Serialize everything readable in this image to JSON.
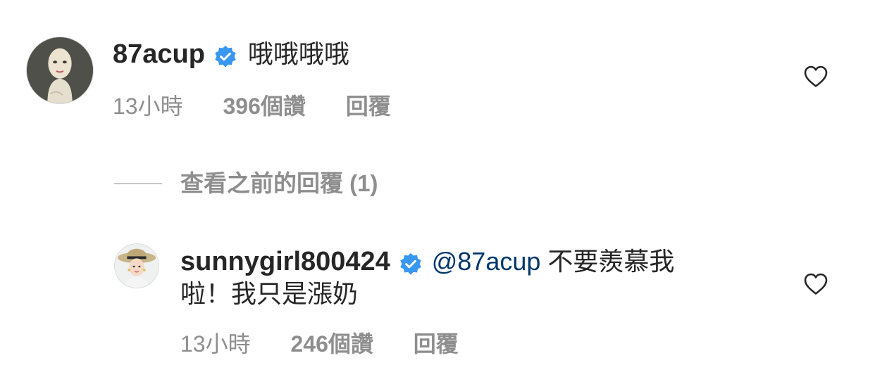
{
  "comment": {
    "username": "87acup",
    "verified_icon": "verified-badge-icon",
    "text": "哦哦哦哦",
    "time": "13小時",
    "likes": "396個讚",
    "reply_label": "回覆",
    "like_icon": "heart-outline-icon"
  },
  "view_replies": {
    "label": "查看之前的回覆 (1)"
  },
  "reply": {
    "username": "sunnygirl800424",
    "verified_icon": "verified-badge-icon",
    "mention": "@87acup",
    "text_line1": " 不要羨慕我",
    "text_line2": "啦！我只是漲奶",
    "time": "13小時",
    "likes": "246個讚",
    "reply_label": "回覆",
    "like_icon": "heart-outline-icon"
  },
  "colors": {
    "text_primary": "#262626",
    "text_secondary": "#8e8e8e",
    "mention": "#00376b",
    "verified": "#3897f0",
    "background": "#ffffff"
  }
}
